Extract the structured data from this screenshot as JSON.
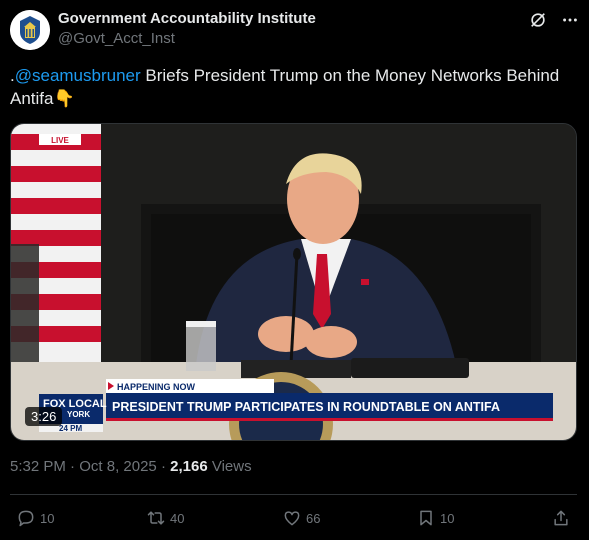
{
  "author": {
    "display_name": "Government Accountability Institute",
    "handle": "@Govt_Acct_Inst"
  },
  "tweet": {
    "prefix": ".",
    "mention": "@seamusbruner",
    "text": " Briefs President Trump on the Money Networks Behind Antifa",
    "emoji": "👇"
  },
  "video": {
    "live_label": "LIVE",
    "happening_now": "HAPPENING NOW",
    "headline": "PRESIDENT TRUMP PARTICIPATES IN ROUNDTABLE ON ANTIFA",
    "network": "FOX LOCAL",
    "city": "YORK",
    "clock": "24 PM",
    "duration": "3:26"
  },
  "meta": {
    "time": "5:32 PM",
    "sep1": " · ",
    "date": "Oct 8, 2025",
    "sep2": " · ",
    "views_count": "2,166",
    "views_label": " Views"
  },
  "actions": {
    "replies": "10",
    "reposts": "40",
    "likes": "66",
    "bookmarks": "10"
  },
  "colors": {
    "accent": "#1d9bf0",
    "muted": "#71767b",
    "fox_blue": "#0a2a6b",
    "fox_red": "#c8102e"
  }
}
